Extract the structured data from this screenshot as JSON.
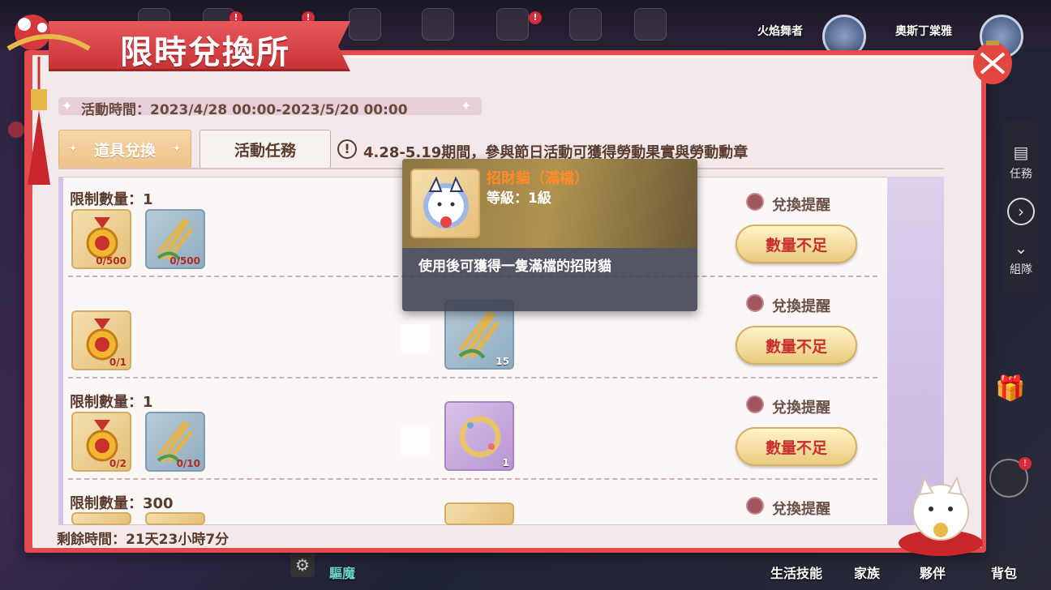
{
  "hud": {
    "player1_name": "火焰舞者",
    "player2_name": "奧斯丁棠雅",
    "badge": "!"
  },
  "right_bar": {
    "tasks_label": "任務",
    "team_label": "組隊"
  },
  "bottom_bar": {
    "exorcise_label": "驅魔",
    "life_skills_label": "生活技能",
    "family_label": "家族",
    "partner_label": "夥伴",
    "bag_label": "背包"
  },
  "panel": {
    "title": "限時兌換所",
    "event_time": "活動時間：2023/4/28 00:00-2023/5/20 00:00",
    "tabs": [
      {
        "label": "道具兌換",
        "active": true
      },
      {
        "label": "活動任務",
        "active": false
      }
    ],
    "notice_icon": "!",
    "notice": "4.28-5.19期間，參與節日活動可獲得勞動果實與勞動勳章",
    "remaining_time": "剩餘時間：21天23小時7分"
  },
  "rows": [
    {
      "limit": "限制數量：1",
      "costs": [
        {
          "icon": "labor-medal-icon",
          "count": "0/500"
        },
        {
          "icon": "wheat-icon",
          "count": "0/500"
        }
      ],
      "reward": {
        "icon": "lucky-cat-icon",
        "count": ""
      },
      "remind_label": "兌換提醒",
      "button_label": "數量不足"
    },
    {
      "limit": "",
      "costs": [
        {
          "icon": "labor-medal-icon",
          "count": "0/1"
        }
      ],
      "reward": {
        "icon": "wheat-icon",
        "count": "15"
      },
      "remind_label": "兌換提醒",
      "button_label": "數量不足"
    },
    {
      "limit": "限制數量：1",
      "costs": [
        {
          "icon": "labor-medal-icon",
          "count": "0/2"
        },
        {
          "icon": "wheat-icon",
          "count": "0/10"
        }
      ],
      "reward": {
        "icon": "wreath-icon",
        "count": "1"
      },
      "remind_label": "兌換提醒",
      "button_label": "數量不足"
    },
    {
      "limit": "限制數量：300",
      "costs": [
        {
          "icon": "labor-medal-icon",
          "count": ""
        },
        {
          "icon": "wheat-icon",
          "count": ""
        }
      ],
      "reward": {
        "icon": "item-icon",
        "count": ""
      },
      "remind_label": "兌換提醒",
      "button_label": ""
    }
  ],
  "tooltip": {
    "name": "招財貓（滿檔）",
    "level": "等級：1級",
    "description": "使用後可獲得一隻滿檔的招財貓"
  },
  "colors": {
    "panel_border": "#e44b4e",
    "button_text": "#c8302e",
    "tooltip_name": "#ff8a2a"
  }
}
